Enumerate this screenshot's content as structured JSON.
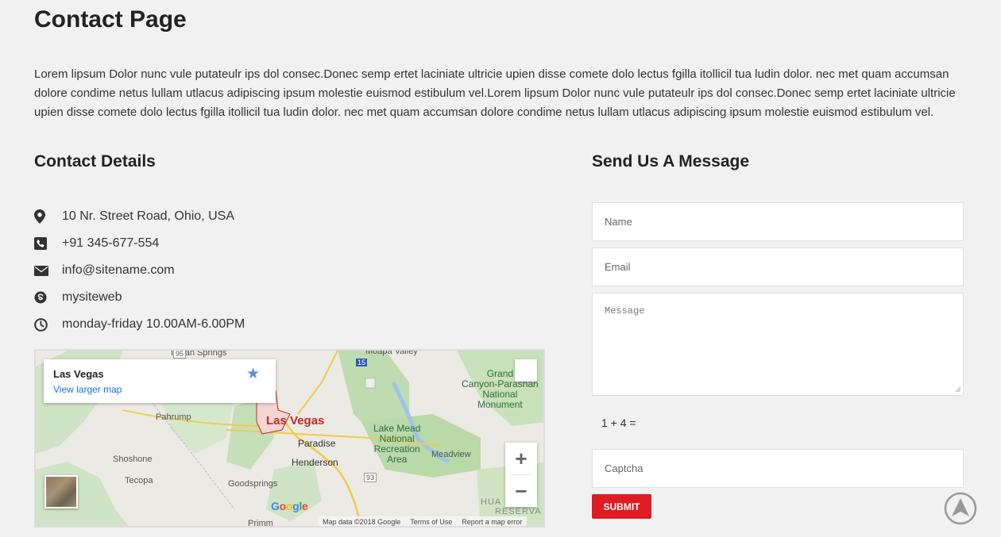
{
  "page": {
    "title": "Contact Page",
    "intro": "Lorem lipsum Dolor nunc vule putateulr ips dol consec.Donec semp ertet laciniate ultricie upien disse comete dolo lectus fgilla itollicil tua ludin dolor. nec met quam accumsan dolore condime netus lullam utlacus adipiscing ipsum molestie euismod estibulum vel.Lorem lipsum Dolor nunc vule putateulr ips dol consec.Donec semp ertet laciniate ultricie upien disse comete dolo lectus fgilla itollicil tua ludin dolor. nec met quam accumsan dolore condime netus lullam utlacus adipiscing ipsum molestie euismod estibulum vel."
  },
  "contact": {
    "title": "Contact Details",
    "items": [
      {
        "icon": "map-marker-icon",
        "text": "10 Nr. Street Road, Ohio, USA"
      },
      {
        "icon": "phone-icon",
        "text": "+91 345-677-554"
      },
      {
        "icon": "envelope-icon",
        "text": "info@sitename.com"
      },
      {
        "icon": "skype-icon",
        "text": "mysiteweb"
      },
      {
        "icon": "clock-icon",
        "text": "monday-friday 10.00AM-6.00PM"
      }
    ]
  },
  "map": {
    "place_name": "Las Vegas",
    "larger_map_link": "View larger map",
    "zoom_in": "+",
    "zoom_out": "−",
    "labels": {
      "las_vegas": "Las Vegas",
      "paradise": "Paradise",
      "henderson": "Henderson",
      "pahrump": "Pahrump",
      "shoshone": "Shoshone",
      "tecopa": "Tecopa",
      "goodsprings": "Goodsprings",
      "primm": "Primm",
      "indian_springs": "Indian Springs",
      "moapa_valley": "Moapa Valley",
      "meadview": "Meadview",
      "lake_mead_1": "Lake Mead",
      "lake_mead_2": "National",
      "lake_mead_3": "Recreation",
      "lake_mead_4": "Area",
      "grand_1": "Grand",
      "grand_2": "Canyon-Parashan",
      "grand_3": "National",
      "grand_4": "Monument",
      "hualapai": "HUA",
      "reserva": "RESERVA",
      "route_95": "95",
      "route_15": "15",
      "route_93": "93"
    },
    "google_logo": "Google",
    "attribution": {
      "data": "Map data ©2018 Google",
      "terms": "Terms of Use",
      "report": "Report a map error"
    }
  },
  "form": {
    "title": "Send Us A Message",
    "name_placeholder": "Name",
    "email_placeholder": "Email",
    "message_placeholder": "Message",
    "captcha_question": "1 + 4 =",
    "captcha_placeholder": "Captcha",
    "submit_label": "SUBMIT"
  },
  "colors": {
    "accent": "#e01b24",
    "link": "#1a73e8",
    "background": "#f1f1f1"
  }
}
